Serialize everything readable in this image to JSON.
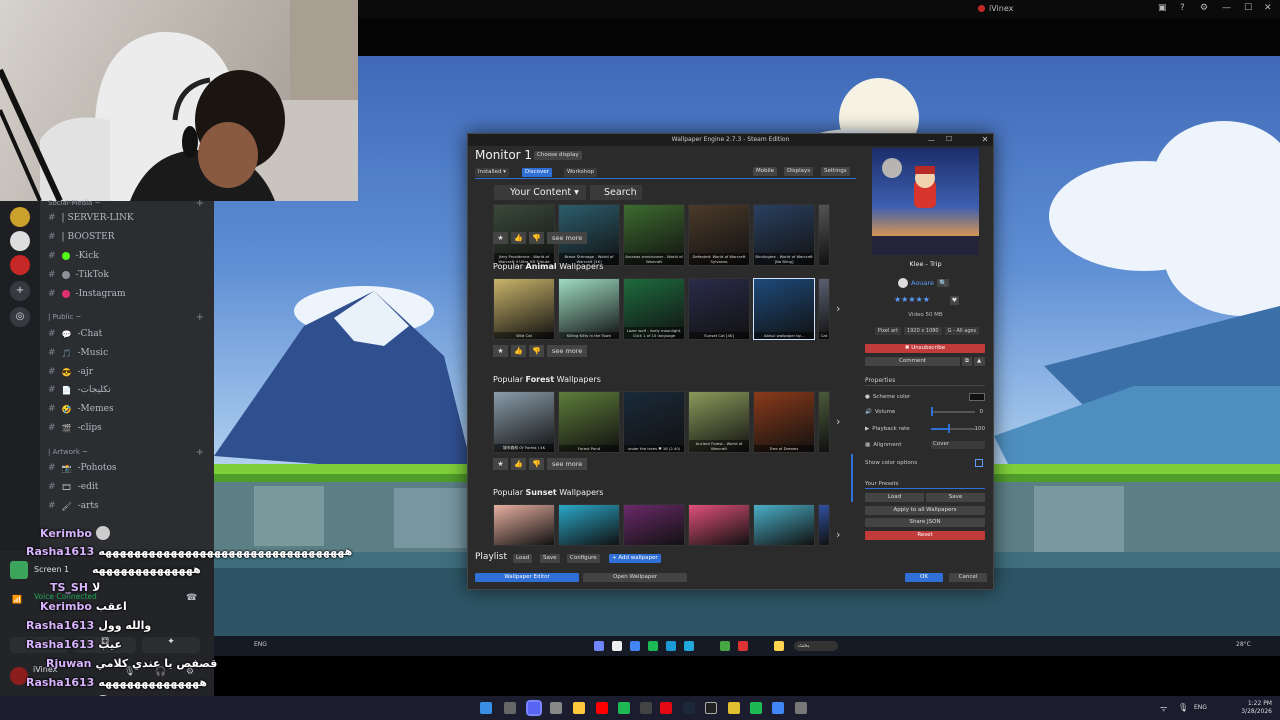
{
  "viewer": {
    "title": "iVinex"
  },
  "discord": {
    "categories": [
      {
        "label": "Social-Media ~"
      },
      {
        "label": "| Public ~"
      },
      {
        "label": "| Artwork ~"
      }
    ],
    "channels": [
      {
        "label": "| SERVER-LINK"
      },
      {
        "label": "| BOOSTER"
      },
      {
        "label": "-Kick",
        "color": "#53fc18"
      },
      {
        "label": "-TikTok",
        "color": "#8e9297"
      },
      {
        "label": "-Instagram",
        "color": "#e1306c"
      },
      {
        "label": "-Chat",
        "icon": "💬"
      },
      {
        "label": "-Music",
        "icon": "🎵"
      },
      {
        "label": "-ajr",
        "icon": "😎"
      },
      {
        "label": "-تكليجات",
        "icon": "📄"
      },
      {
        "label": "-Memes",
        "icon": "🤣"
      },
      {
        "label": "-clips",
        "icon": "🎬"
      },
      {
        "label": "-Pohotos",
        "icon": "📸"
      },
      {
        "label": "-edit",
        "icon": "🎞"
      },
      {
        "label": "-arts",
        "icon": "🖌"
      }
    ],
    "voice": {
      "screen_label": "Screen 1",
      "status": "Voice Connected",
      "user": "iVinex"
    }
  },
  "chat": [
    {
      "user": "Kerimbo",
      "msg": ""
    },
    {
      "user": "Rasha1613",
      "msg": "ههههههههههههههههههههههههههههههههههه"
    },
    {
      "user": "",
      "msg": "ههههههههههههههه"
    },
    {
      "user": "TS_SH",
      "msg": "لا"
    },
    {
      "user": "Kerimbo",
      "msg": "اعقب"
    },
    {
      "user": "Rasha1613",
      "msg": "والله وول"
    },
    {
      "user": "Rasha1613",
      "msg": "عيب"
    },
    {
      "user": "Rjuwan",
      "msg": "قصفص يا عندي كلامي"
    },
    {
      "user": "Rasha1613",
      "msg": "ههههههههههههههه"
    },
    {
      "user": "Rjuwan",
      "msg": ""
    }
  ],
  "we": {
    "title": "Wallpaper Engine 2.7.3 - Steam Edition",
    "monitor": "Monitor 1",
    "choose_display": "Choose display",
    "tabs": {
      "installed": "Installed",
      "discover": "Discover",
      "workshop": "Workshop"
    },
    "tools": {
      "mobile": "Mobile",
      "displays": "Displays",
      "settings": "Settings"
    },
    "your_content": "Your Content",
    "search": "Search",
    "see_more": "see more",
    "top_captions": [
      "Jiery Providence - World of Warcraft 4 Ultra HD Tribute",
      "Brave Strimage - World of Warcraft [4K]",
      "Arcanas windrunner - World of Warcraft",
      "Defeated: World of Warcraft Sylvanas",
      "Bindingtex - World of Warcraft [No Bling]",
      ""
    ],
    "sections": [
      {
        "title_pre": "Popular ",
        "title_key": "Animal",
        "title_post": " Wallpapers",
        "captions": [
          "Wild Cat",
          "Killing Kitty in the Town",
          "Lazer wolf - lively moonlight. Click 1 of 10 language",
          "Sunset Cat [4K]",
          "Abisul wallpaper by...",
          "Cat"
        ]
      },
      {
        "title_pre": "Popular ",
        "title_key": "Forest",
        "title_post": " Wallpapers",
        "captions": [
          "城市森林 Of Forest / 4K",
          "Forest Pond",
          "under the trees ♥ 16 (2.40)",
          "Ancient Forest - World of Warcraft",
          "Tree of Dreams",
          ""
        ]
      },
      {
        "title_pre": "Popular ",
        "title_key": "Sunset",
        "title_post": " Wallpapers",
        "captions": [
          "",
          "",
          "",
          "",
          "",
          ""
        ]
      }
    ],
    "playlist": {
      "label": "Playlist",
      "load": "Load",
      "save": "Save",
      "configure": "Configure",
      "add": "+ Add wallpaper"
    },
    "bottom": {
      "editor": "Wallpaper Editor",
      "open": "Open Wallpaper",
      "ok": "OK",
      "cancel": "Cancel"
    },
    "preview": {
      "name": "Klee - Trip",
      "author": "Aouare",
      "rating": 5,
      "size": "Video 50 MB",
      "tags": [
        "Pixel art",
        "1920 x 1080",
        "G - All ages"
      ],
      "unsubscribe": "✖ Unsubscribe",
      "comment": "Comment",
      "properties": "Properties",
      "scheme_color": "Scheme color",
      "volume": "Volume",
      "volume_val": "0",
      "playback": "Playback rate",
      "playback_val": "100",
      "alignment": "Alignment",
      "alignment_val": "Cover",
      "show_color": "Show color options",
      "presets": "Your Presets",
      "load": "Load",
      "save": "Save",
      "apply_all": "Apply to all Wallpapers",
      "share": "Share JSON",
      "reset": "Reset"
    },
    "colors": {
      "accent": "#2f6fd6",
      "danger": "#c23b3b"
    }
  },
  "inner_taskbar": {
    "lang": "ENG",
    "weather": "28°C",
    "search": "بحث"
  },
  "host_taskbar": {
    "lang": "ENG",
    "time": "1:22 PM",
    "date": "3/28/2026"
  }
}
